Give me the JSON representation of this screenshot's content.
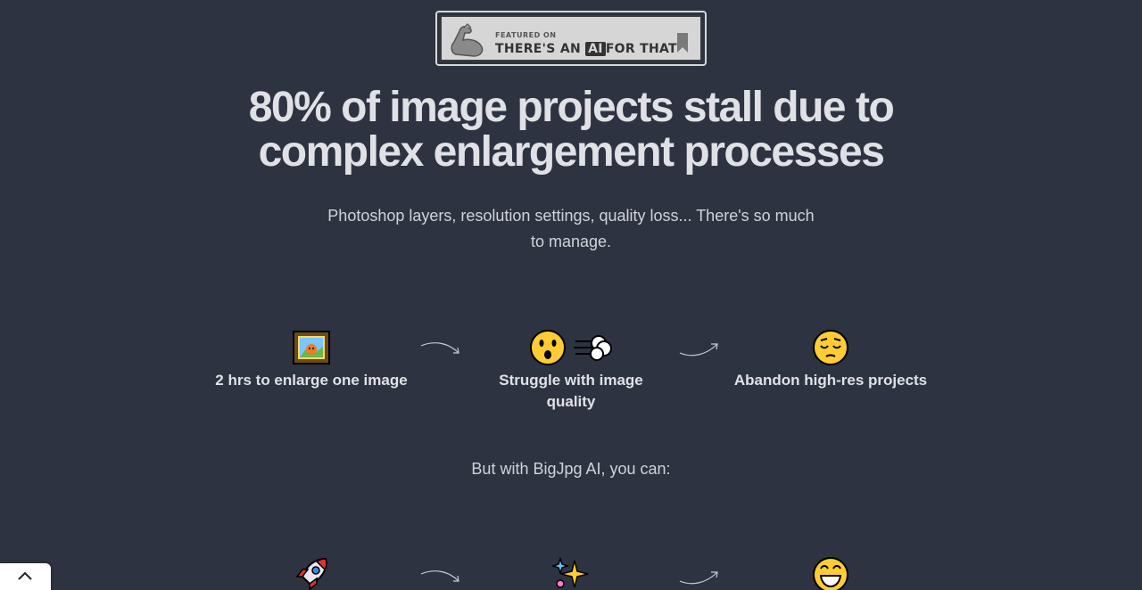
{
  "badge": {
    "small_text": "FEATURED ON",
    "big_text_before": "THERE'S AN",
    "big_text_ai": "AI",
    "big_text_after": "FOR THAT"
  },
  "headline": {
    "line1": "80% of image projects stall due to",
    "line2": "complex enlargement processes"
  },
  "subtext": "Photoshop layers, resolution settings, quality loss... There's so much to manage.",
  "problem_steps": [
    {
      "emoji": "framed-picture",
      "label": "2 hrs to enlarge one image"
    },
    {
      "emoji": "surprised-face-with-dash",
      "label": "Struggle with image quality"
    },
    {
      "emoji": "pensive-face",
      "label": "Abandon high-res projects"
    }
  ],
  "transition_text": "But with BigJpg AI, you can:",
  "solution_steps": [
    {
      "emoji": "rocket"
    },
    {
      "emoji": "sparkles"
    },
    {
      "emoji": "grinning-face"
    }
  ],
  "colors": {
    "background": "#2d3340",
    "heading": "#dfe1e6",
    "body_text": "#d0d3da",
    "badge_bg": "#d6d6d6"
  },
  "scroll_top_icon": "chevron-up-icon"
}
